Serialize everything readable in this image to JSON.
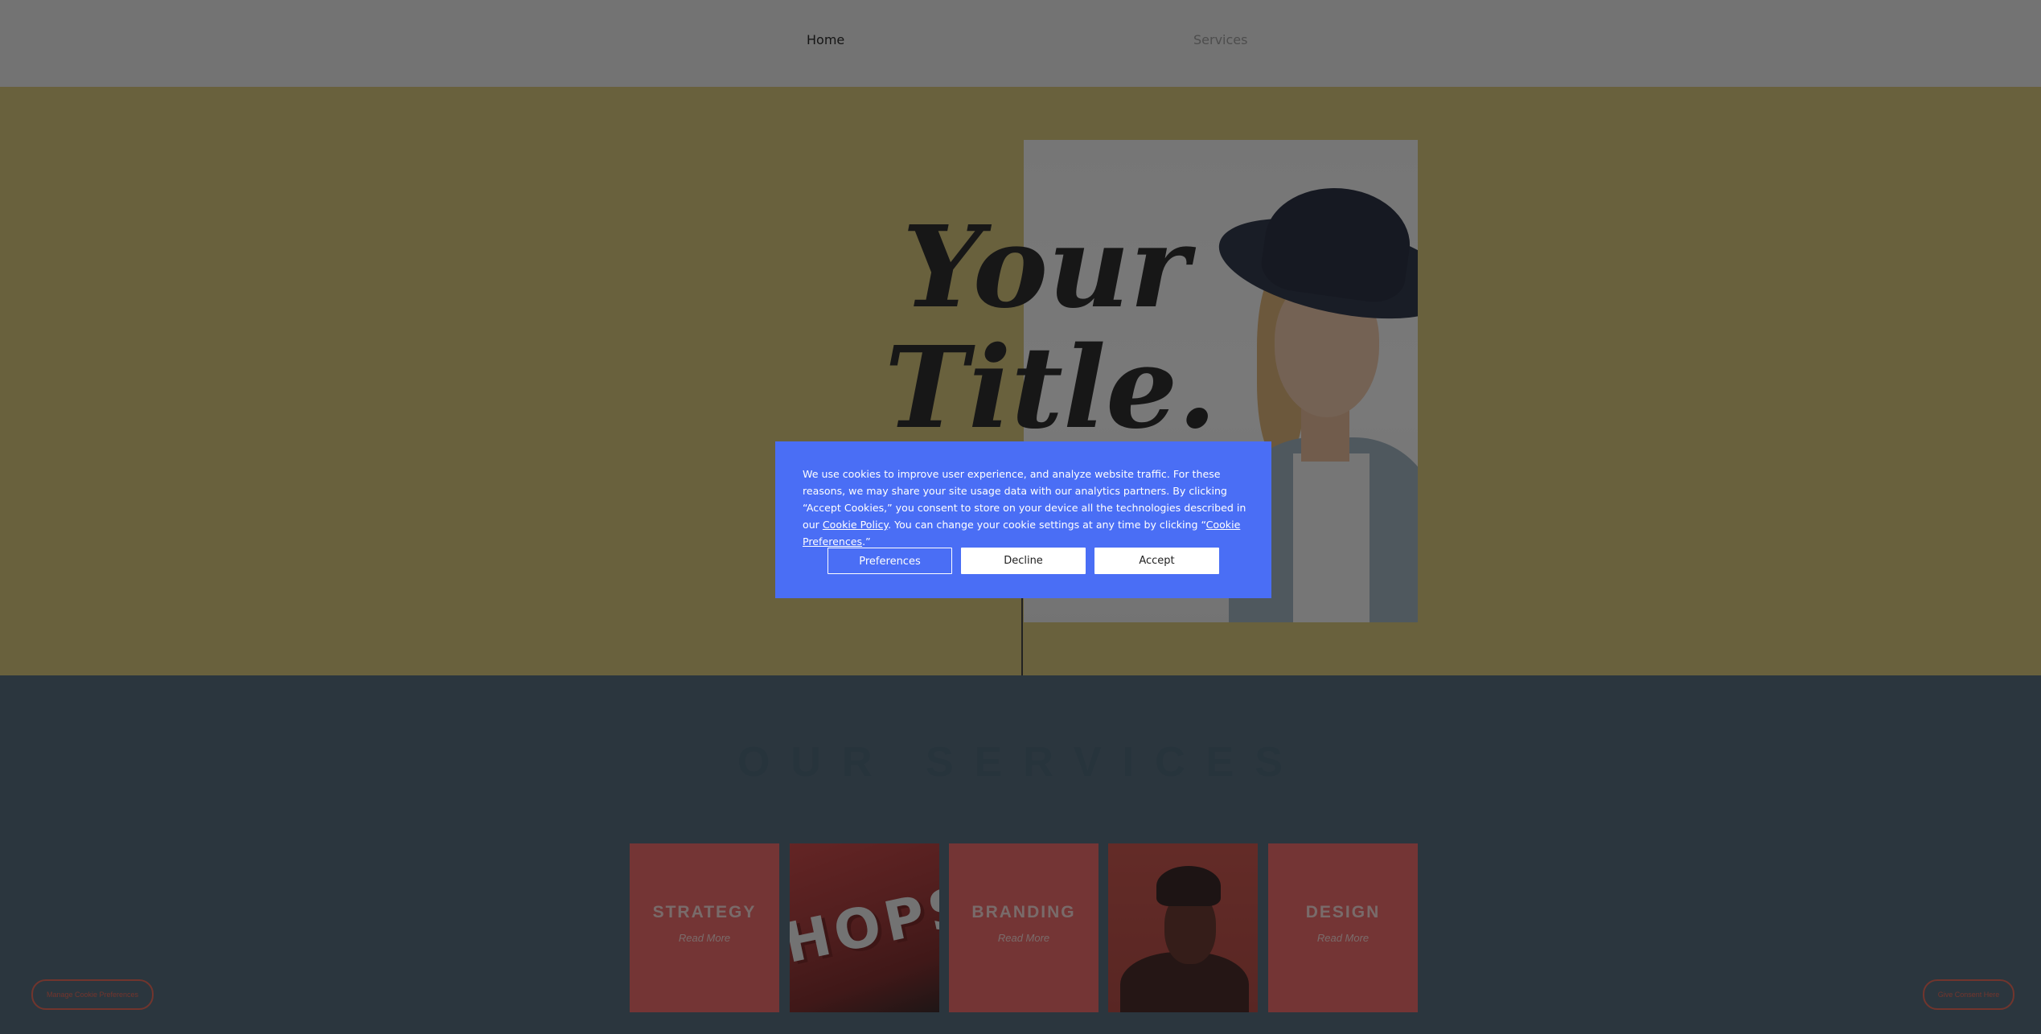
{
  "nav": {
    "items": [
      {
        "label": "Home"
      },
      {
        "label": "Services"
      }
    ]
  },
  "hero": {
    "title_line1": "Your",
    "title_line2": "Title."
  },
  "services": {
    "heading": "OUR SERVICES",
    "cards": [
      {
        "title": "STRATEGY",
        "link": "Read More"
      },
      {
        "photo_text": "HOPS"
      },
      {
        "title": "BRANDING",
        "link": "Read More"
      },
      {
        "title": "DESIGN",
        "link": "Read More"
      }
    ]
  },
  "footer_buttons": {
    "left": "Manage Cookie Preferences",
    "right": "Give Consent Here"
  },
  "cookie_banner": {
    "text_1": "We use cookies to improve user experience, and analyze website traffic. For these reasons, we may share your site usage data with our analytics partners. By clicking “Accept Cookies,” you consent to store on your device all the technologies described in our ",
    "policy_link": "Cookie Policy",
    "text_2": ". You can change your cookie settings at any time by clicking “",
    "preferences_link": "Cookie Preferences",
    "text_3": ".”",
    "buttons": {
      "preferences": "Preferences",
      "decline": "Decline",
      "accept": "Accept"
    }
  },
  "colors": {
    "banner_bg": "#4a6ef5",
    "hero_bg": "#d3c27a",
    "services_bg": "#566c7d",
    "card_pink": "#e96a6a"
  }
}
